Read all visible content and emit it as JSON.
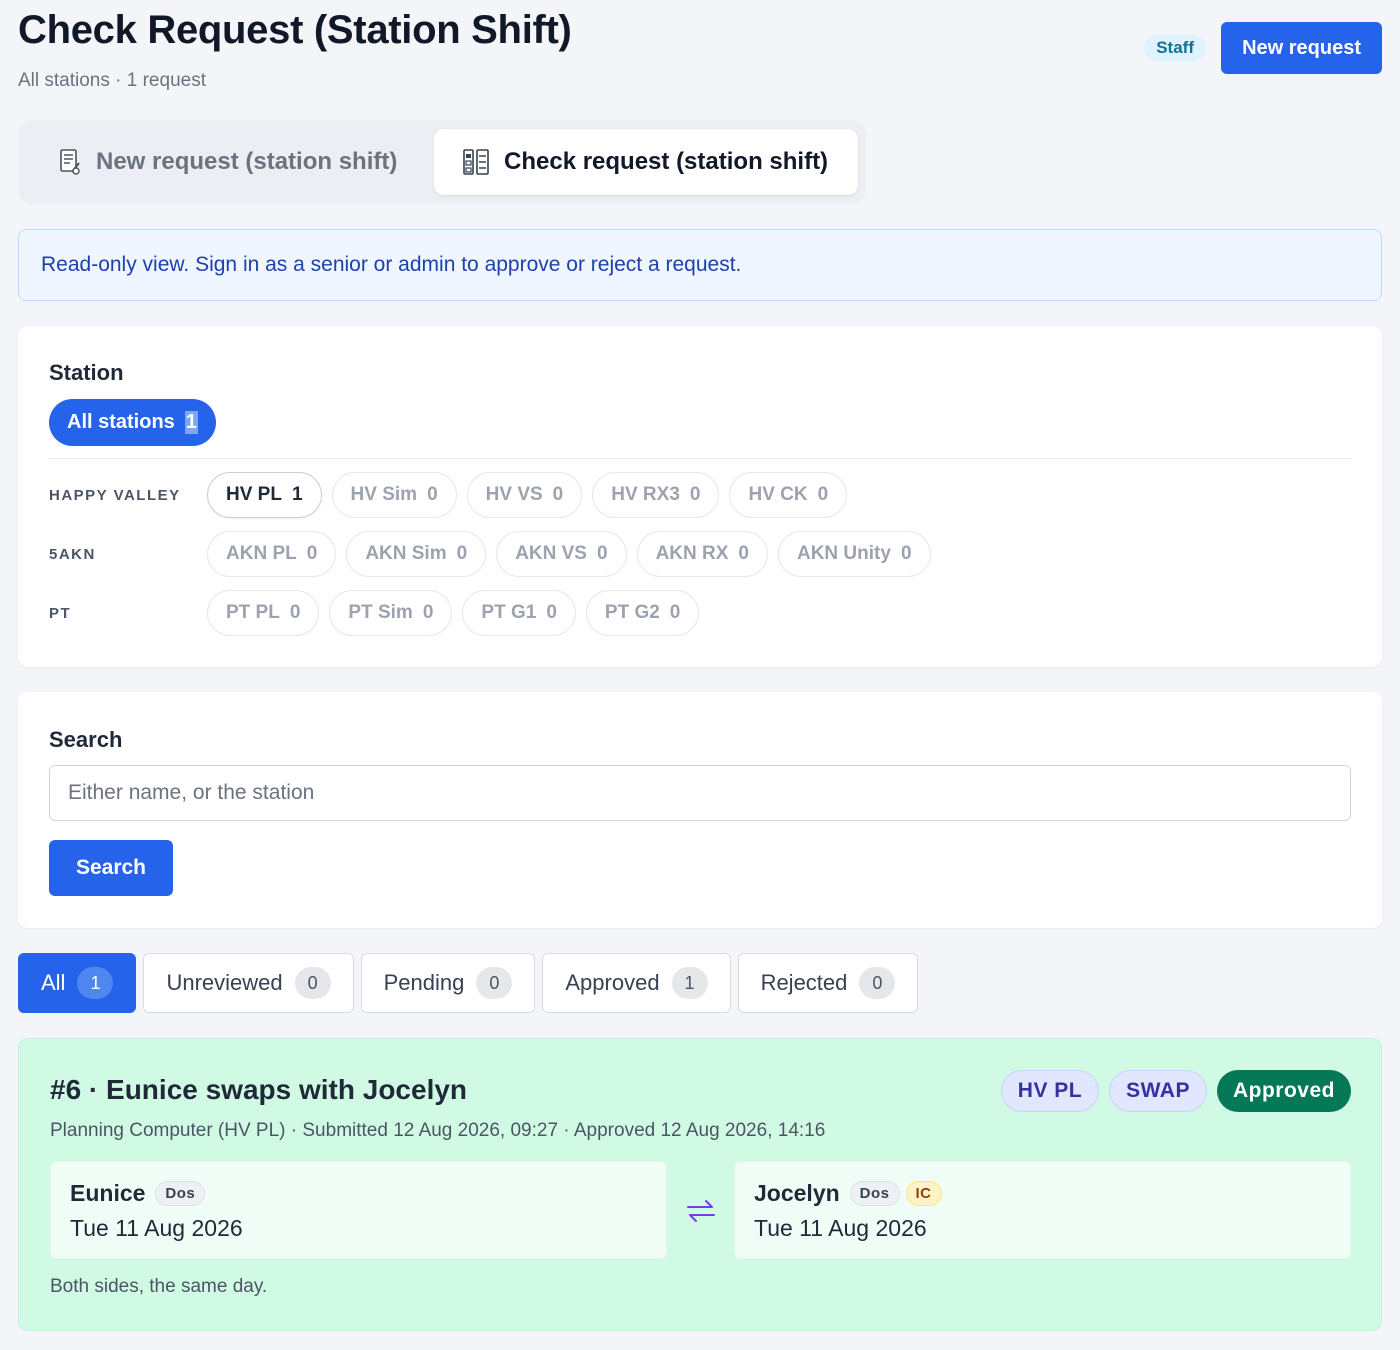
{
  "header": {
    "title": "Check Request (Station Shift)",
    "subtitle": "All stations · 1 request",
    "role_badge": "Staff",
    "new_request_label": "New request"
  },
  "tabs": [
    {
      "label": "New request (station shift)",
      "icon": "notepad-icon",
      "active": false
    },
    {
      "label": "Check request (station shift)",
      "icon": "checklist-icon",
      "active": true
    }
  ],
  "notice": "Read-only view. Sign in as a senior or admin to approve or reject a request.",
  "station_filter": {
    "label": "Station",
    "all": {
      "label": "All stations",
      "count": "1"
    },
    "groups": [
      {
        "name": "HAPPY VALLEY",
        "stations": [
          {
            "label": "HV PL",
            "count": "1",
            "active": true
          },
          {
            "label": "HV Sim",
            "count": "0"
          },
          {
            "label": "HV VS",
            "count": "0"
          },
          {
            "label": "HV RX3",
            "count": "0"
          },
          {
            "label": "HV CK",
            "count": "0"
          }
        ]
      },
      {
        "name": "5AKN",
        "stations": [
          {
            "label": "AKN PL",
            "count": "0"
          },
          {
            "label": "AKN Sim",
            "count": "0"
          },
          {
            "label": "AKN VS",
            "count": "0"
          },
          {
            "label": "AKN RX",
            "count": "0"
          },
          {
            "label": "AKN Unity",
            "count": "0"
          }
        ]
      },
      {
        "name": "PT",
        "stations": [
          {
            "label": "PT PL",
            "count": "0"
          },
          {
            "label": "PT Sim",
            "count": "0"
          },
          {
            "label": "PT G1",
            "count": "0"
          },
          {
            "label": "PT G2",
            "count": "0"
          }
        ]
      }
    ]
  },
  "search": {
    "label": "Search",
    "placeholder": "Either name, or the station",
    "value": "",
    "button_label": "Search"
  },
  "status_filters": [
    {
      "label": "All",
      "count": "1",
      "active": true
    },
    {
      "label": "Unreviewed",
      "count": "0"
    },
    {
      "label": "Pending",
      "count": "0"
    },
    {
      "label": "Approved",
      "count": "1"
    },
    {
      "label": "Rejected",
      "count": "0"
    }
  ],
  "requests": [
    {
      "title": "#6 · Eunice swaps with Jocelyn",
      "badges": [
        "HV PL",
        "SWAP"
      ],
      "status": "Approved",
      "meta": "Planning Computer (HV PL) · Submitted 12 Aug 2026, 09:27 · Approved 12 Aug 2026, 14:16",
      "from": {
        "name": "Eunice",
        "tags": [
          "Dos"
        ],
        "date": "Tue 11 Aug 2026"
      },
      "to": {
        "name": "Jocelyn",
        "tags": [
          "Dos",
          "IC"
        ],
        "date": "Tue 11 Aug 2026"
      },
      "swap_icon": "swap-arrows-icon",
      "note": "Both sides, the same day."
    }
  ],
  "colors": {
    "accent": "#2563eb",
    "approved_bg": "#d1fae5",
    "approved_badge": "#047857",
    "notice_text": "#1e40af"
  }
}
